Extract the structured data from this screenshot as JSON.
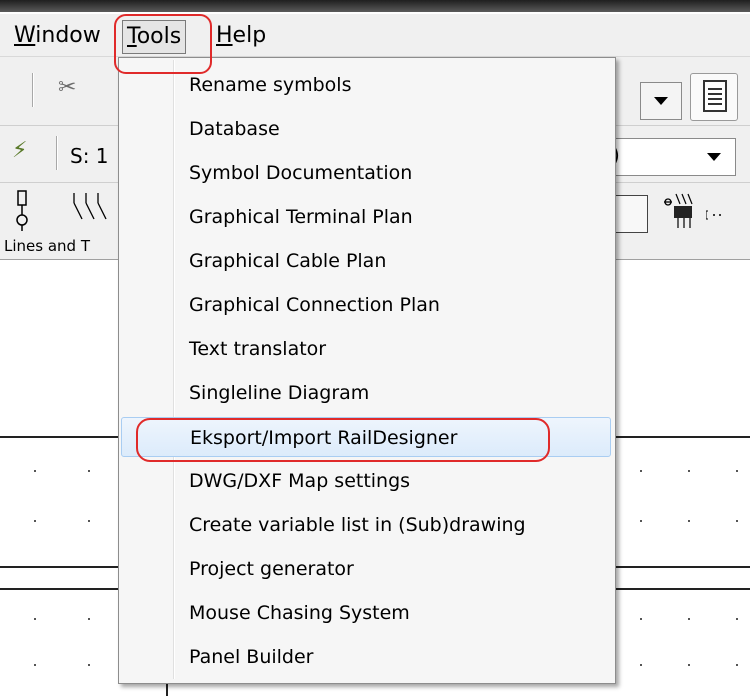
{
  "menubar": {
    "items": [
      {
        "label_mnemonic": "W",
        "label_rest": "indow"
      },
      {
        "label_mnemonic": "T",
        "label_rest": "ools"
      },
      {
        "label_mnemonic": "H",
        "label_rest": "elp"
      }
    ]
  },
  "toolbar": {
    "s_field_label": "S: 1",
    "combo_fragment": ")",
    "panel_tab_label": "Lines and T"
  },
  "tools_menu": {
    "items": [
      "Rename symbols",
      "Database",
      "Symbol Documentation",
      "Graphical Terminal Plan",
      "Graphical Cable Plan",
      "Graphical Connection Plan",
      "Text translator",
      "Singleline Diagram",
      "Eksport/Import RailDesigner",
      "DWG/DXF Map settings",
      "Create variable list in (Sub)drawing",
      "Project generator",
      "Mouse Chasing System",
      "Panel Builder"
    ],
    "hovered_item": "Eksport/Import RailDesigner"
  },
  "colors": {
    "annotation_red": "#e02a2a",
    "menu_background": "#f6f6f6",
    "hover_border": "#a9cdf2"
  }
}
